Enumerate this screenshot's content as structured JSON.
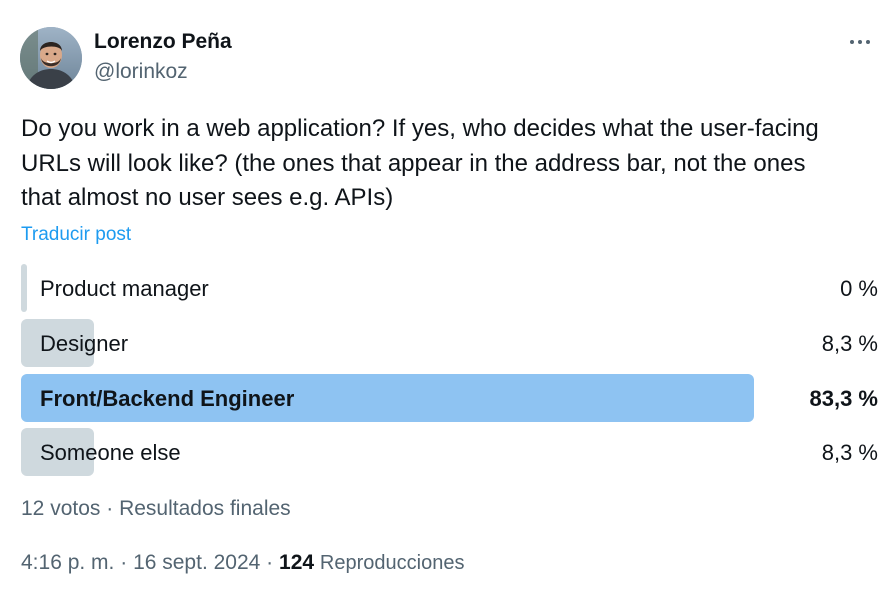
{
  "author": {
    "name": "Lorenzo Peña",
    "handle": "@lorinkoz"
  },
  "tweet": {
    "text": "Do you work in a web application? If yes, who decides what the user-facing URLs will look like? (the ones that appear in the address bar, not the ones that almost no user sees e.g. APIs)",
    "translate_label": "Traducir post"
  },
  "poll": {
    "options": [
      {
        "label": "Product manager",
        "percent_text": "0 %",
        "percent": 0,
        "winner": false
      },
      {
        "label": "Designer",
        "percent_text": "8,3 %",
        "percent": 8.3,
        "winner": false
      },
      {
        "label": "Front/Backend Engineer",
        "percent_text": "83,3 %",
        "percent": 83.3,
        "winner": true
      },
      {
        "label": "Someone else",
        "percent_text": "8,3 %",
        "percent": 8.3,
        "winner": false
      }
    ],
    "summary": {
      "votes": "12 votos",
      "separator": " · ",
      "status": "Resultados finales"
    }
  },
  "meta": {
    "time": "4:16 p. m.",
    "date": "16 sept. 2024",
    "separator": " · ",
    "views_count": "124",
    "views_label": "Reproducciones"
  },
  "icons": {
    "more": "more-horizontal-icon"
  },
  "colors": {
    "text_primary": "#0f1419",
    "text_secondary": "#536471",
    "link": "#1d9bf0",
    "poll_bar": "#cfd9de",
    "poll_bar_winner": "#8ec3f2"
  }
}
